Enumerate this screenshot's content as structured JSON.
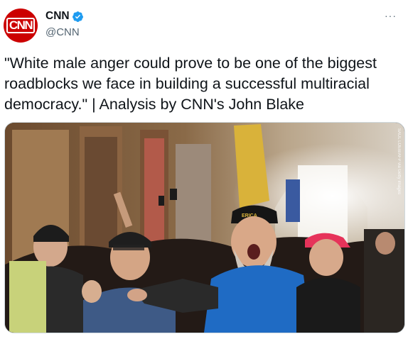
{
  "account": {
    "display_name": "CNN",
    "handle": "@CNN",
    "avatar_text": "CNN",
    "verified": true,
    "avatar_color": "#cc0000",
    "verified_color": "#1d9bf0"
  },
  "tweet": {
    "text": "\"White male anger could prove to be one of the biggest roadblocks we face in building a successful multiracial democracy.\" | Analysis by CNN's John Blake"
  },
  "media": {
    "image_credit": "SAUL LOEB/AFP via Getty Images",
    "hat_text": "ERICA"
  },
  "more_menu": {
    "icon": "ellipsis-icon",
    "label": "···"
  }
}
